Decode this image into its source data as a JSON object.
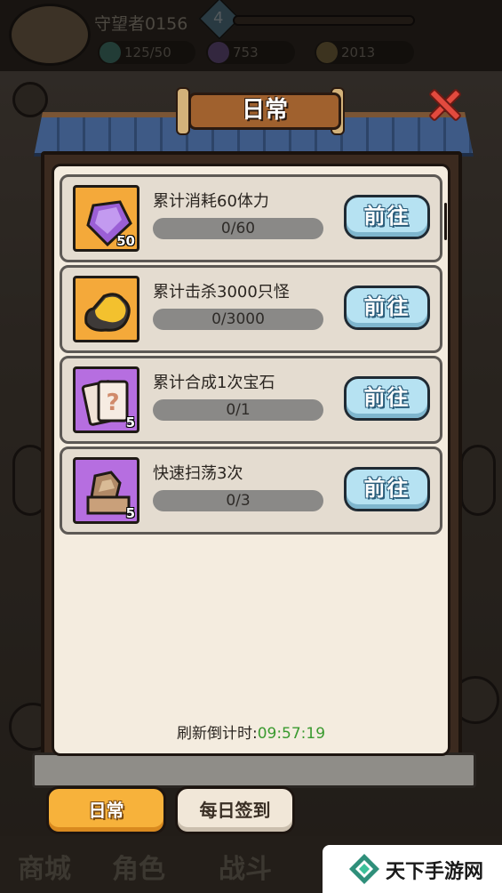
{
  "hud": {
    "player_name": "守望者0156",
    "level": "4",
    "stats": [
      "125/50",
      "753",
      "2013"
    ]
  },
  "bottom_nav": [
    "商城",
    "角色",
    "战斗"
  ],
  "panel": {
    "title": "日常",
    "tasks": [
      {
        "title": "累计消耗60体力",
        "progress": "0/60",
        "icon": "purple-gem-icon",
        "icon_count": "50",
        "bg": "orange"
      },
      {
        "title": "累计击杀3000只怪",
        "progress": "0/3000",
        "icon": "gold-ore-icon",
        "icon_count": "",
        "bg": "orange"
      },
      {
        "title": "累计合成1次宝石",
        "progress": "0/1",
        "icon": "mystery-cards-icon",
        "icon_count": "5",
        "bg": "purple"
      },
      {
        "title": "快速扫荡3次",
        "progress": "0/3",
        "icon": "stone-blocks-icon",
        "icon_count": "5",
        "bg": "purple"
      }
    ],
    "go_label": "前往",
    "refresh_label": "刷新倒计时:",
    "refresh_time": "09:57:19"
  },
  "tabs": {
    "daily": "日常",
    "signin": "每日签到"
  },
  "watermark": "天下手游网",
  "colors": {
    "accent_orange": "#f7b23b",
    "go_button": "#b6e2f2",
    "timer_green": "#3a9a2f",
    "close_red": "#e24a3e"
  }
}
